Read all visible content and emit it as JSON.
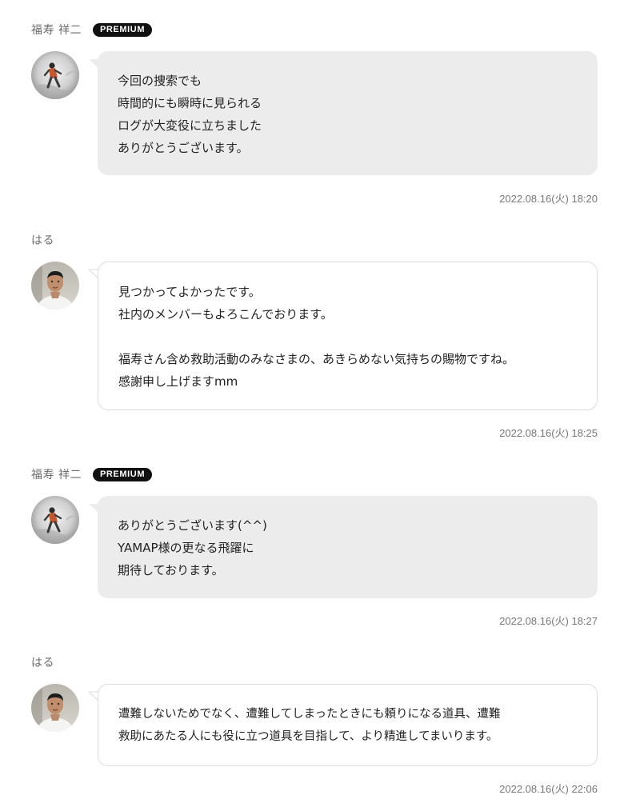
{
  "colors": {
    "badge_bg": "#111111",
    "bubble_grey": "#ececec",
    "bubble_border": "#dcdcdc",
    "meta_text": "#777777"
  },
  "messages": [
    {
      "author": "福寿 祥二",
      "badge": "PREMIUM",
      "avatar_icon": "user-avatar-fukuju",
      "text": "今回の捜索でも\n時間的にも瞬時に見られる\nログが大変役に立ちました\nありがとうございます。",
      "time": "2022.08.16(火) 18:20"
    },
    {
      "author": "はる",
      "avatar_icon": "user-avatar-haru",
      "text": "見つかってよかったです。\n社内のメンバーもよろこんでおります。\n\n福寿さん含め救助活動のみなさまの、あきらめない気持ちの賜物ですね。\n感謝申し上げますmm",
      "time": "2022.08.16(火) 18:25"
    },
    {
      "author": "福寿 祥二",
      "badge": "PREMIUM",
      "avatar_icon": "user-avatar-fukuju",
      "text": "ありがとうございます(^^)\nYAMAP様の更なる飛躍に\n期待しております。",
      "time": "2022.08.16(火) 18:27"
    },
    {
      "author": "はる",
      "avatar_icon": "user-avatar-haru",
      "text": "遭難しないためでなく、遭難してしまったときにも頼りになる道具、遭難\n救助にあたる人にも役に立つ道具を目指して、より精進してまいります。",
      "time": "2022.08.16(火) 22:06"
    }
  ]
}
